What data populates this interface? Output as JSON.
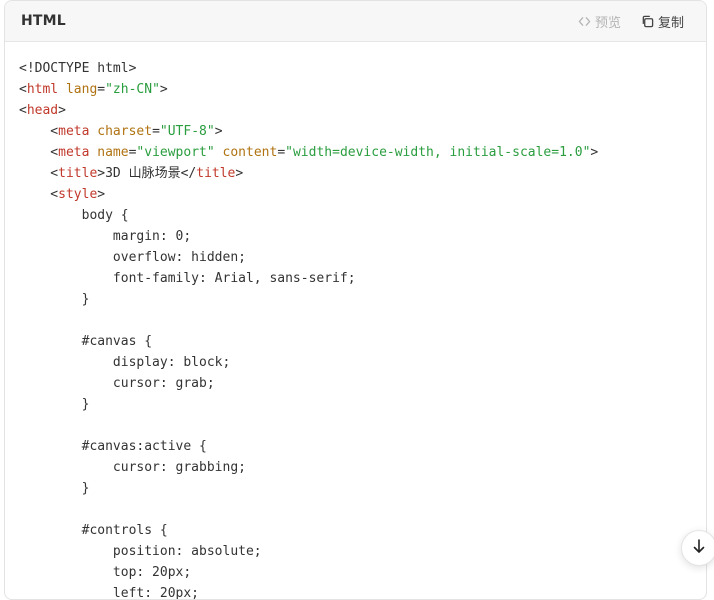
{
  "header": {
    "language": "HTML",
    "preview_label": "预览",
    "copy_label": "复制"
  },
  "icons": {
    "preview": "code-brackets-icon",
    "copy": "copy-icon",
    "scroll": "arrow-down-icon"
  },
  "colors": {
    "tag": "#c0392b",
    "attribute": "#b07312",
    "string": "#2a9d3f",
    "text": "#333333"
  },
  "code_lines": [
    [
      {
        "t": "txt",
        "v": "<!DOCTYPE html>"
      }
    ],
    [
      {
        "t": "txt",
        "v": "<"
      },
      {
        "t": "tag",
        "v": "html"
      },
      {
        "t": "txt",
        "v": " "
      },
      {
        "t": "attr",
        "v": "lang"
      },
      {
        "t": "txt",
        "v": "="
      },
      {
        "t": "str",
        "v": "\"zh-CN\""
      },
      {
        "t": "txt",
        "v": ">"
      }
    ],
    [
      {
        "t": "txt",
        "v": "<"
      },
      {
        "t": "tag",
        "v": "head"
      },
      {
        "t": "txt",
        "v": ">"
      }
    ],
    [
      {
        "t": "txt",
        "v": "    <"
      },
      {
        "t": "tag",
        "v": "meta"
      },
      {
        "t": "txt",
        "v": " "
      },
      {
        "t": "attr",
        "v": "charset"
      },
      {
        "t": "txt",
        "v": "="
      },
      {
        "t": "str",
        "v": "\"UTF-8\""
      },
      {
        "t": "txt",
        "v": ">"
      }
    ],
    [
      {
        "t": "txt",
        "v": "    <"
      },
      {
        "t": "tag",
        "v": "meta"
      },
      {
        "t": "txt",
        "v": " "
      },
      {
        "t": "attr",
        "v": "name"
      },
      {
        "t": "txt",
        "v": "="
      },
      {
        "t": "str",
        "v": "\"viewport\""
      },
      {
        "t": "txt",
        "v": " "
      },
      {
        "t": "attr",
        "v": "content"
      },
      {
        "t": "txt",
        "v": "="
      },
      {
        "t": "str",
        "v": "\"width=device-width, initial-scale=1.0\""
      },
      {
        "t": "txt",
        "v": ">"
      }
    ],
    [
      {
        "t": "txt",
        "v": "    <"
      },
      {
        "t": "tag",
        "v": "title"
      },
      {
        "t": "txt",
        "v": ">3D 山脉场景</"
      },
      {
        "t": "tag",
        "v": "title"
      },
      {
        "t": "txt",
        "v": ">"
      }
    ],
    [
      {
        "t": "txt",
        "v": "    <"
      },
      {
        "t": "tag",
        "v": "style"
      },
      {
        "t": "txt",
        "v": ">"
      }
    ],
    [
      {
        "t": "txt",
        "v": "        body {"
      }
    ],
    [
      {
        "t": "txt",
        "v": "            margin: 0;"
      }
    ],
    [
      {
        "t": "txt",
        "v": "            overflow: hidden;"
      }
    ],
    [
      {
        "t": "txt",
        "v": "            font-family: Arial, sans-serif;"
      }
    ],
    [
      {
        "t": "txt",
        "v": "        }"
      }
    ],
    [
      {
        "t": "txt",
        "v": ""
      }
    ],
    [
      {
        "t": "txt",
        "v": "        #canvas {"
      }
    ],
    [
      {
        "t": "txt",
        "v": "            display: block;"
      }
    ],
    [
      {
        "t": "txt",
        "v": "            cursor: grab;"
      }
    ],
    [
      {
        "t": "txt",
        "v": "        }"
      }
    ],
    [
      {
        "t": "txt",
        "v": ""
      }
    ],
    [
      {
        "t": "txt",
        "v": "        #canvas:active {"
      }
    ],
    [
      {
        "t": "txt",
        "v": "            cursor: grabbing;"
      }
    ],
    [
      {
        "t": "txt",
        "v": "        }"
      }
    ],
    [
      {
        "t": "txt",
        "v": ""
      }
    ],
    [
      {
        "t": "txt",
        "v": "        #controls {"
      }
    ],
    [
      {
        "t": "txt",
        "v": "            position: absolute;"
      }
    ],
    [
      {
        "t": "txt",
        "v": "            top: 20px;"
      }
    ],
    [
      {
        "t": "txt",
        "v": "            left: 20px;"
      }
    ]
  ]
}
